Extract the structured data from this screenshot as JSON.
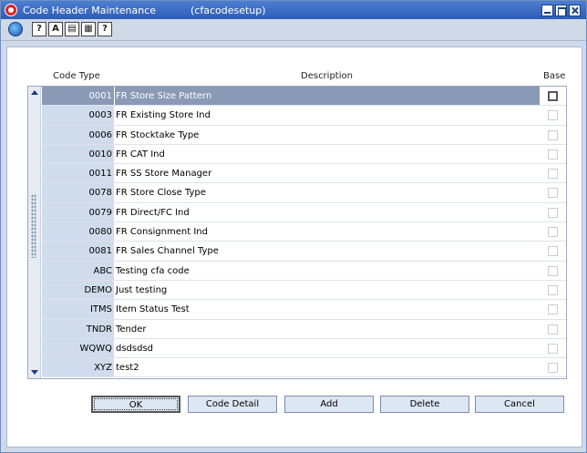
{
  "window": {
    "title": "Code Header Maintenance",
    "form_name": "(cfacodesetup)"
  },
  "toolbar": {
    "icons": [
      "globe-icon",
      "key-icon",
      "help-icon",
      "calendar-icon",
      "clipboard-icon",
      "question-icon"
    ],
    "button_glyphs": [
      "?",
      "A",
      "▤",
      "▦",
      "?"
    ]
  },
  "grid": {
    "headers": {
      "code": "Code Type",
      "description": "Description",
      "base": "Base"
    },
    "rows": [
      {
        "code": "0001",
        "description": "FR Store Size Pattern",
        "base": false,
        "selected": true
      },
      {
        "code": "0003",
        "description": "FR Existing Store Ind",
        "base": false
      },
      {
        "code": "0006",
        "description": "FR Stocktake Type",
        "base": false
      },
      {
        "code": "0010",
        "description": "FR CAT Ind",
        "base": false
      },
      {
        "code": "0011",
        "description": "FR SS Store Manager",
        "base": false
      },
      {
        "code": "0078",
        "description": "FR Store Close Type",
        "base": false
      },
      {
        "code": "0079",
        "description": "FR Direct/FC Ind",
        "base": false
      },
      {
        "code": "0080",
        "description": "FR Consignment Ind",
        "base": false
      },
      {
        "code": "0081",
        "description": "FR Sales Channel Type",
        "base": false
      },
      {
        "code": "ABC",
        "description": "Testing cfa code",
        "base": false
      },
      {
        "code": "DEMO",
        "description": "Just testing",
        "base": false
      },
      {
        "code": "ITMS",
        "description": "Item Status Test",
        "base": false
      },
      {
        "code": "TNDR",
        "description": "Tender",
        "base": false
      },
      {
        "code": "WQWQ",
        "description": "dsdsdsd",
        "base": false
      },
      {
        "code": "XYZ",
        "description": "test2",
        "base": false
      }
    ]
  },
  "buttons": {
    "ok": "OK",
    "code_detail": "Code Detail",
    "add": "Add",
    "delete": "Delete",
    "cancel": "Cancel"
  },
  "colors": {
    "titlebar": "#2d5cb5",
    "selected_row": "#8a9ab6",
    "code_column": "#d0dbec"
  }
}
